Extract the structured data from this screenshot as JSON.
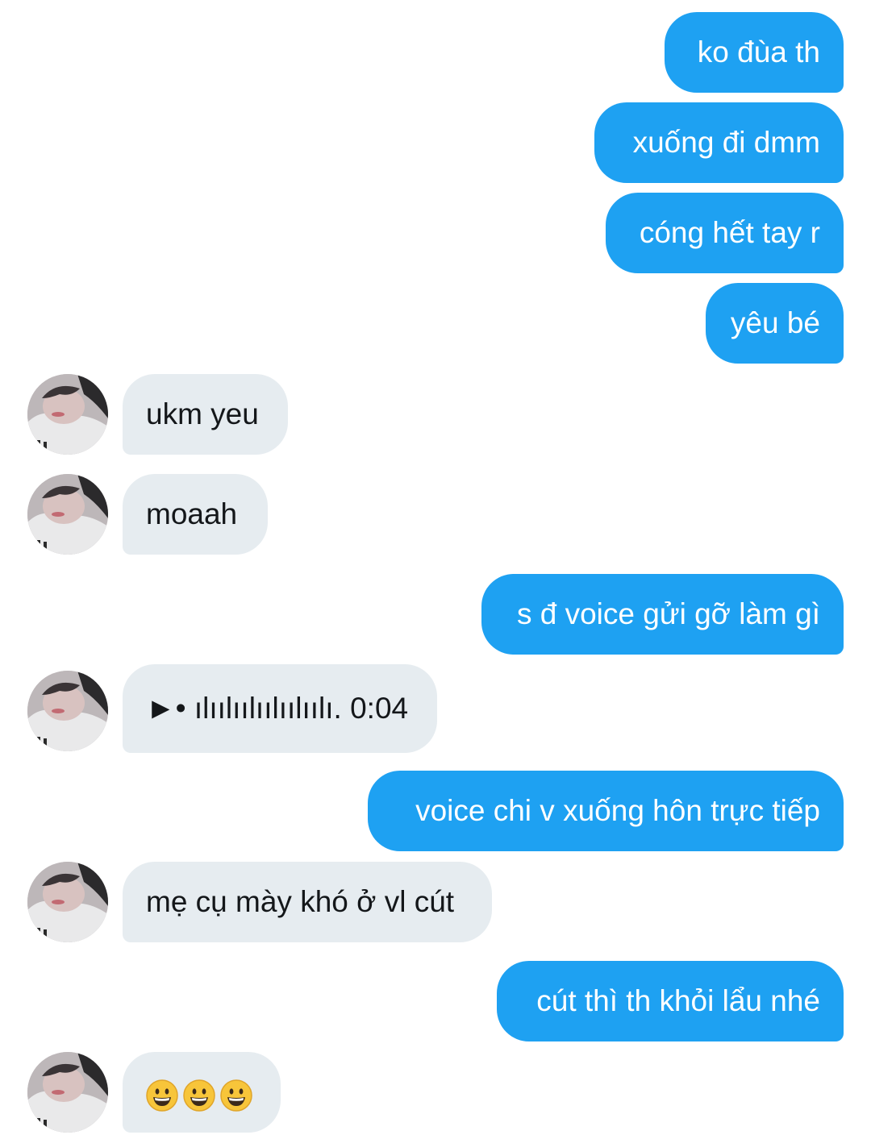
{
  "thread": {
    "messages": [
      {
        "side": "out",
        "text": "ko đùa th"
      },
      {
        "side": "out",
        "text": "xuống đi dmm"
      },
      {
        "side": "out",
        "text": "cóng hết tay r"
      },
      {
        "side": "out",
        "text": "yêu bé"
      },
      {
        "side": "in",
        "text": "ukm yeu"
      },
      {
        "side": "in",
        "text": "moaah"
      },
      {
        "side": "out",
        "text": "s đ voice gửi gỡ làm gì"
      },
      {
        "side": "in",
        "text": "►• ılıılıılıılıılıılı. 0:04"
      },
      {
        "side": "out",
        "text": "voice chi v xuống hôn trực tiếp"
      },
      {
        "side": "in",
        "text": "mẹ cụ mày khó ở vl cút"
      },
      {
        "side": "out",
        "text": "cút thì th khỏi lẩu nhé"
      },
      {
        "side": "in",
        "text": "😀😀😀",
        "emoji_count": 3
      }
    ]
  },
  "avatar": {
    "icon": "contact-avatar-photo"
  },
  "colors": {
    "outgoing_bubble": "#1ea1f2",
    "outgoing_text": "#ffffff",
    "incoming_bubble": "#e6ecf0",
    "incoming_text": "#14171a",
    "background": "#ffffff"
  }
}
